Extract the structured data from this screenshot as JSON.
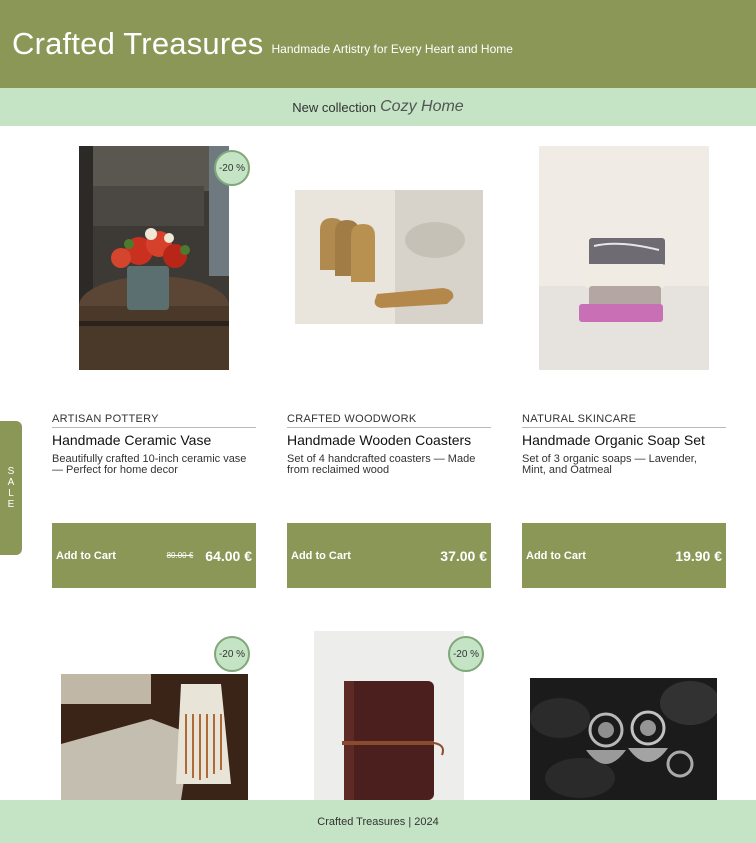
{
  "header": {
    "title": "Crafted Treasures",
    "tagline": "Handmade Artistry for Every Heart and Home"
  },
  "banner": {
    "prefix": "New collection",
    "collection": "Cozy Home"
  },
  "sale_tab": "SALE",
  "products": [
    {
      "category": "ARTISAN POTTERY",
      "title": "Handmade Ceramic Vase",
      "description": "Beautifully crafted 10-inch ceramic vase — Perfect for home decor",
      "discount": "-20 %",
      "old_price": "80.00 €",
      "price": "64.00 €",
      "cart_label": "Add to Cart",
      "image": "vase-with-red-flowers-on-barrel"
    },
    {
      "category": "CRAFTED WOODWORK",
      "title": "Handmade Wooden Coasters",
      "description": "Set of 4 handcrafted coasters — Made from reclaimed wood",
      "price": "37.00 €",
      "cart_label": "Add to Cart",
      "image": "wooden-coasters"
    },
    {
      "category": "NATURAL SKINCARE",
      "title": "Handmade Organic Soap Set",
      "description": "Set of 3 organic soaps — Lavender, Mint, and Oatmeal",
      "price": "19.90 €",
      "cart_label": "Add to Cart",
      "image": "stacked-soap-bars"
    },
    {
      "discount": "-20 %",
      "image": "woven-textile-with-fringe"
    },
    {
      "discount": "-20 %",
      "image": "leather-journal"
    },
    {
      "image": "silver-earrings-on-black-stones"
    }
  ],
  "footer": "Crafted Treasures | 2024",
  "colors": {
    "primary": "#8a9757",
    "accent_light": "#c5e3c5"
  }
}
